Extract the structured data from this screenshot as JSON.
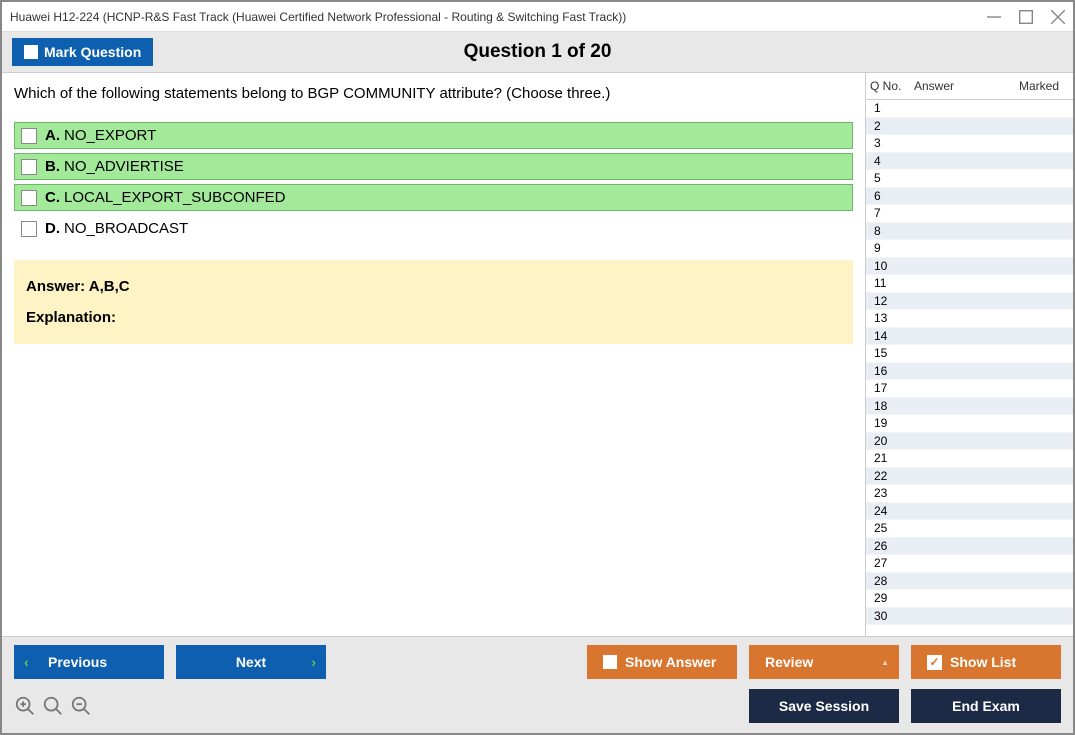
{
  "window": {
    "title": "Huawei H12-224 (HCNP-R&S Fast Track (Huawei Certified Network Professional - Routing & Switching Fast Track))"
  },
  "header": {
    "mark_label": "Mark Question",
    "question_header": "Question 1 of 20"
  },
  "question": {
    "text": "Which of the following statements belong to BGP COMMUNITY attribute? (Choose three.)",
    "options": [
      {
        "letter": "A.",
        "text": "NO_EXPORT",
        "correct": true
      },
      {
        "letter": "B.",
        "text": "NO_ADVIERTISE",
        "correct": true
      },
      {
        "letter": "C.",
        "text": "LOCAL_EXPORT_SUBCONFED",
        "correct": true
      },
      {
        "letter": "D.",
        "text": "NO_BROADCAST",
        "correct": false
      }
    ]
  },
  "answer_box": {
    "answer_label": "Answer: A,B,C",
    "explanation_label": "Explanation:"
  },
  "side_panel": {
    "col_qno": "Q No.",
    "col_answer": "Answer",
    "col_marked": "Marked",
    "rows": [
      1,
      2,
      3,
      4,
      5,
      6,
      7,
      8,
      9,
      10,
      11,
      12,
      13,
      14,
      15,
      16,
      17,
      18,
      19,
      20,
      21,
      22,
      23,
      24,
      25,
      26,
      27,
      28,
      29,
      30
    ]
  },
  "footer": {
    "previous": "Previous",
    "next": "Next",
    "show_answer": "Show Answer",
    "review": "Review",
    "show_list": "Show List",
    "save_session": "Save Session",
    "end_exam": "End Exam"
  }
}
